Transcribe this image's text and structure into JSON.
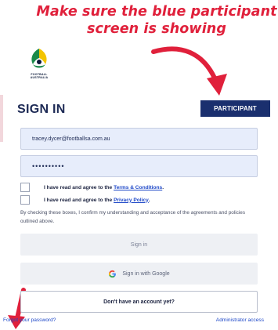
{
  "annotation": {
    "line1": "Make sure the blue participant",
    "line2": "screen is showing"
  },
  "logo": {
    "line1": "FOOTBALL",
    "line2": "AUSTRALIA"
  },
  "header": {
    "title": "SIGN IN",
    "participant_label": "PARTICIPANT"
  },
  "form": {
    "email_value": "tracey.dycer@footballsa.com.au",
    "password_value": "••••••••••",
    "terms_prefix": "I have read and agree to the",
    "terms_link": "Terms & Conditions",
    "privacy_prefix": "I have read and agree to the",
    "privacy_link": "Privacy Policy",
    "disclaimer": "By checking these boxes, I confirm my understanding and acceptance of the agreements and policies outlined above."
  },
  "buttons": {
    "signin": "Sign in",
    "google": "Sign in with Google",
    "create_account": "Don't have an account yet?"
  },
  "footer": {
    "forgot": "Forgot your password?",
    "admin": "Administrator access"
  },
  "colors": {
    "annotation": "#e0203b",
    "participant_bg": "#1a2f6e",
    "link": "#1e48c8",
    "field_bg": "#e7edfb"
  }
}
